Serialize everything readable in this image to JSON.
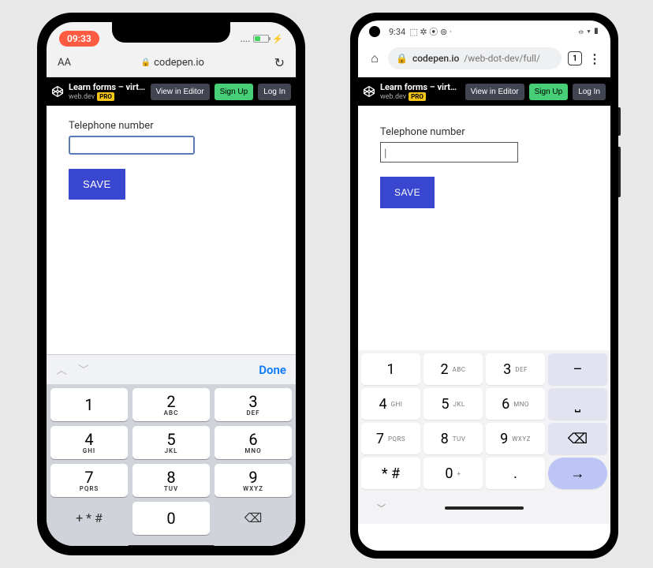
{
  "ios": {
    "status": {
      "time": "09:33",
      "signal": "....",
      "charging": "⚡"
    },
    "urlbar": {
      "aa": "AA",
      "domain": "codepen.io",
      "reload": "↻"
    },
    "codepen": {
      "title": "Learn forms – virt…",
      "author": "web.dev",
      "pro": "PRO",
      "view": "View in Editor",
      "signup": "Sign Up",
      "login": "Log In"
    },
    "page": {
      "label": "Telephone number",
      "value": "",
      "save": "SAVE"
    },
    "kb_acc": {
      "up": "︿",
      "down": "﹀",
      "done": "Done"
    },
    "keys": [
      {
        "d": "1",
        "l": " "
      },
      {
        "d": "2",
        "l": "ABC"
      },
      {
        "d": "3",
        "l": "DEF"
      },
      {
        "d": "4",
        "l": "GHI"
      },
      {
        "d": "5",
        "l": "JKL"
      },
      {
        "d": "6",
        "l": "MNO"
      },
      {
        "d": "7",
        "l": "PQRS"
      },
      {
        "d": "8",
        "l": "TUV"
      },
      {
        "d": "9",
        "l": "WXYZ"
      }
    ],
    "key_sym": "+ * #",
    "key_zero": "0",
    "key_back": "⌫"
  },
  "android": {
    "status": {
      "time": "9:34",
      "icons_left": "⬚ ✲ ⦿ ⊚ ·",
      "icons_right": "⦵ ▾ ▮"
    },
    "urlbar": {
      "home": "⌂",
      "domain": "codepen.io",
      "path": "/web-dot-dev/full/",
      "tabs": "1",
      "menu": "⋮"
    },
    "codepen": {
      "title": "Learn forms – virt…",
      "author": "web.dev",
      "pro": "PRO",
      "view": "View in Editor",
      "signup": "Sign Up",
      "login": "Log In"
    },
    "page": {
      "label": "Telephone number",
      "value": "",
      "cursor": "|",
      "save": "SAVE"
    },
    "keys": [
      {
        "d": "1",
        "l": ""
      },
      {
        "d": "2",
        "l": "ABC"
      },
      {
        "d": "3",
        "l": "DEF"
      },
      {
        "d": "–",
        "side": true
      },
      {
        "d": "4",
        "l": "GHI"
      },
      {
        "d": "5",
        "l": "JKL"
      },
      {
        "d": "6",
        "l": "MNO"
      },
      {
        "d": "⎵",
        "side": true
      },
      {
        "d": "7",
        "l": "PQRS"
      },
      {
        "d": "8",
        "l": "TUV"
      },
      {
        "d": "9",
        "l": "WXYZ"
      },
      {
        "d": "⌫",
        "side": true
      },
      {
        "d": "* #",
        "l": "",
        "sp": true
      },
      {
        "d": "0",
        "l": "+"
      },
      {
        "d": ".",
        "l": ""
      },
      {
        "d": "→",
        "enter": true
      }
    ],
    "nav": {
      "collapse": "﹀"
    }
  }
}
